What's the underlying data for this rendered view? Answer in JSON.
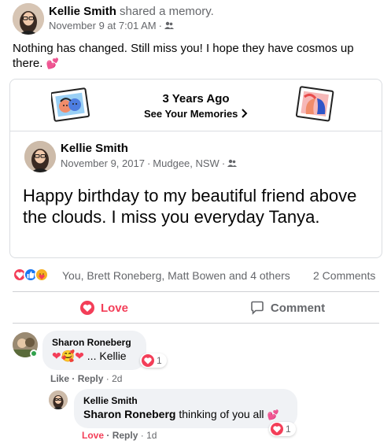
{
  "post": {
    "author": "Kellie Smith",
    "action": "shared a memory.",
    "timestamp": "November 9 at 7:01 AM",
    "audience_icon": "friends-icon",
    "text": "Nothing has changed. Still miss you! I hope they have cosmos up there.",
    "emoji": "💕"
  },
  "memory": {
    "years_ago": "3 Years Ago",
    "see_memories": "See Your Memories",
    "inner_post": {
      "author": "Kellie Smith",
      "date": "November 9, 2017",
      "location": "Mudgee, NSW",
      "audience_icon": "friends-icon",
      "text": "Happy birthday to my beautiful friend above the clouds. I miss you everyday Tanya."
    }
  },
  "reactions": {
    "icons": [
      "love-reaction-icon",
      "like-reaction-icon",
      "care-reaction-icon"
    ],
    "summary": "You, Brett Roneberg, Matt Bowen and 4 others",
    "comments_count": "2 Comments"
  },
  "actions": {
    "love_label": "Love",
    "comment_label": "Comment"
  },
  "comments": [
    {
      "author": "Sharon Roneberg",
      "text": "... Kellie",
      "emoji": "❤🥰❤",
      "reaction_count": "1",
      "like_label": "Like",
      "reply_label": "Reply",
      "age": "2d",
      "online": true
    },
    {
      "author": "Kellie Smith",
      "mention": "Sharon Roneberg",
      "text": "thinking of you all",
      "emoji": "💕",
      "reaction_count": "1",
      "like_label": "Love",
      "reply_label": "Reply",
      "age": "1d"
    }
  ],
  "colors": {
    "love": "#f33e58",
    "like": "#1877f2",
    "care": "#f7b125",
    "secondary_text": "#65676b",
    "online": "#31a24c"
  }
}
